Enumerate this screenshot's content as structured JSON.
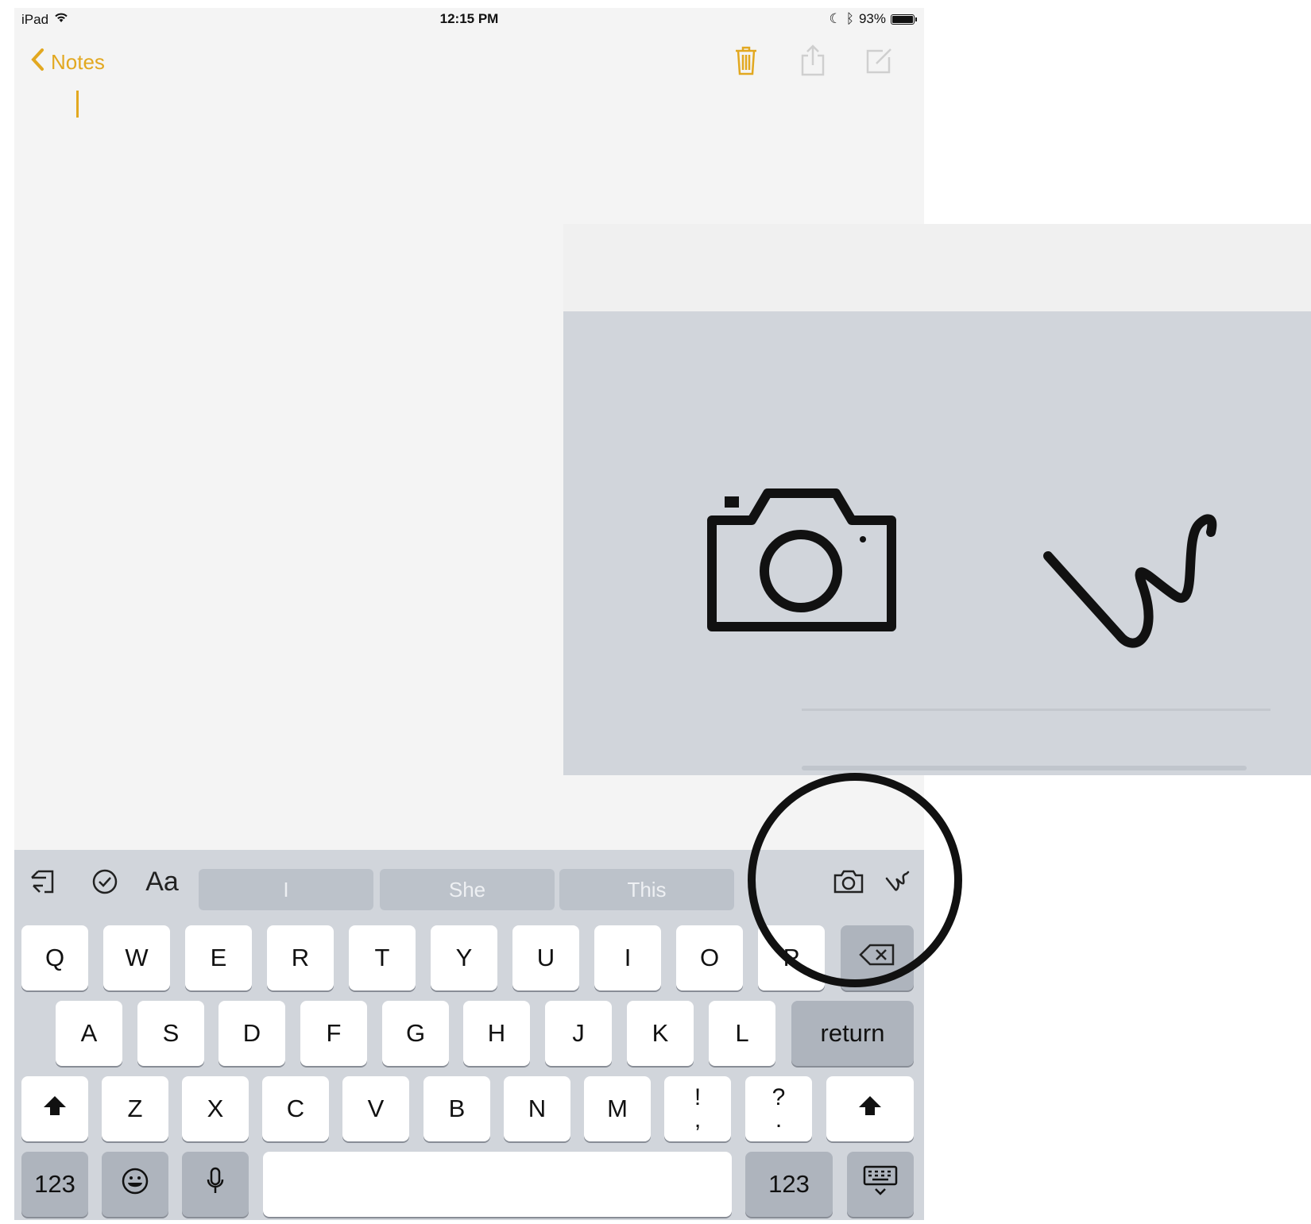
{
  "status_bar": {
    "device": "iPad",
    "time": "12:15 PM",
    "battery": "93%",
    "battery_level": 0.93
  },
  "nav": {
    "back_label": "Notes"
  },
  "keyboard": {
    "suggestions": [
      "I",
      "She",
      "This"
    ],
    "toolbar_format_label": "Aa",
    "row1": [
      "Q",
      "W",
      "E",
      "R",
      "T",
      "Y",
      "U",
      "I",
      "O",
      "P"
    ],
    "row2": [
      "A",
      "S",
      "D",
      "F",
      "G",
      "H",
      "J",
      "K",
      "L"
    ],
    "return_label": "return",
    "row3": [
      "Z",
      "X",
      "C",
      "V",
      "B",
      "N",
      "M"
    ],
    "punct1": {
      "top": "!",
      "bottom": ","
    },
    "punct2": {
      "top": "?",
      "bottom": "."
    },
    "numbers_label": "123"
  },
  "colors": {
    "accent": "#e2a820",
    "keyboard_bg": "#d1d5db",
    "dark_key": "#aeb4bd"
  },
  "icons": [
    "undo-icon",
    "checklist-icon",
    "camera-icon",
    "sketch-icon",
    "trash-icon",
    "share-icon",
    "compose-icon",
    "shift-icon",
    "delete-icon",
    "emoji-icon",
    "microphone-icon",
    "hide-keyboard-icon"
  ]
}
